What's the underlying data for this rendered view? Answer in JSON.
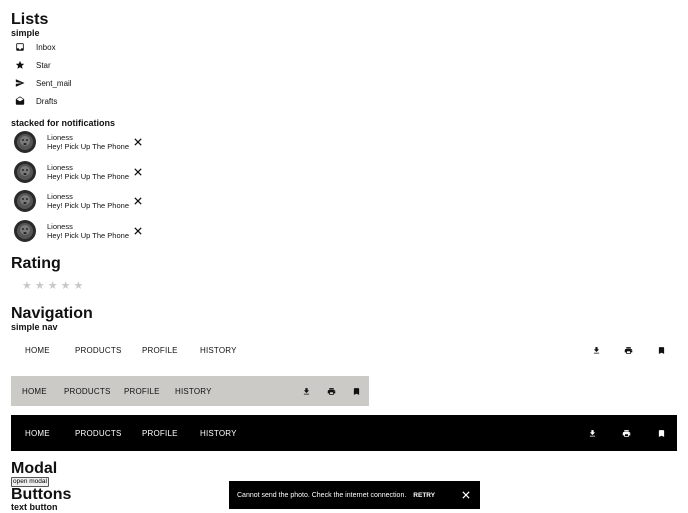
{
  "lists": {
    "title": "Lists",
    "simple_label": "simple",
    "items": [
      {
        "label": "Inbox",
        "icon": "inbox-icon"
      },
      {
        "label": "Star",
        "icon": "star-icon"
      },
      {
        "label": "Sent_mail",
        "icon": "send-icon"
      },
      {
        "label": "Drafts",
        "icon": "drafts-icon"
      }
    ],
    "stacked_label": "stacked for notifications",
    "notifications": [
      {
        "name": "Lioness",
        "message": "Hey! Pick Up The Phone"
      },
      {
        "name": "Lioness",
        "message": "Hey! Pick Up The Phone"
      },
      {
        "name": "Lioness",
        "message": "Hey! Pick Up The Phone"
      },
      {
        "name": "Lioness",
        "message": "Hey! Pick Up The Phone"
      }
    ]
  },
  "rating": {
    "title": "Rating",
    "value": 0,
    "max": 5,
    "star_glyph": "★"
  },
  "navigation": {
    "title": "Navigation",
    "simple_label": "simple nav",
    "items": [
      "HOME",
      "PRODUCTS",
      "PROFILE",
      "HISTORY"
    ],
    "icons": [
      "download-icon",
      "print-icon",
      "bookmark-icon"
    ]
  },
  "modal": {
    "title": "Modal",
    "open_label": "open modal"
  },
  "buttons": {
    "title": "Buttons",
    "text_button_label": "text button"
  },
  "snackbar": {
    "message": "Cannot send the photo. Check the internet connection.",
    "action": "RETRY"
  },
  "colors": {
    "nav_gray": "#cccac6",
    "nav_dark": "#000000",
    "snackbar_bg": "#000000",
    "star_empty": "#c8c8c8"
  }
}
